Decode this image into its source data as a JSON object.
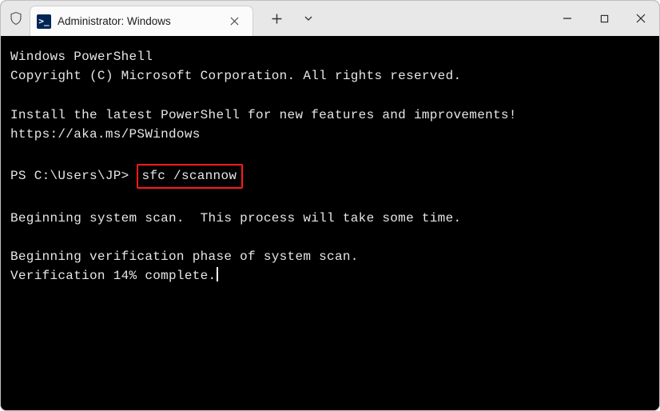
{
  "titlebar": {
    "tab_title": "Administrator: Windows",
    "app_icon_glyph": ">_"
  },
  "terminal": {
    "line_banner1": "Windows PowerShell",
    "line_banner2": "Copyright (C) Microsoft Corporation. All rights reserved.",
    "line_install": "Install the latest PowerShell for new features and improvements!",
    "line_url": "https://aka.ms/PSWindows",
    "prompt": "PS C:\\Users\\JP> ",
    "command": "sfc /scannow",
    "line_scan1": "Beginning system scan.  This process will take some time.",
    "line_phase": "Beginning verification phase of system scan.",
    "line_progress": "Verification 14% complete."
  }
}
